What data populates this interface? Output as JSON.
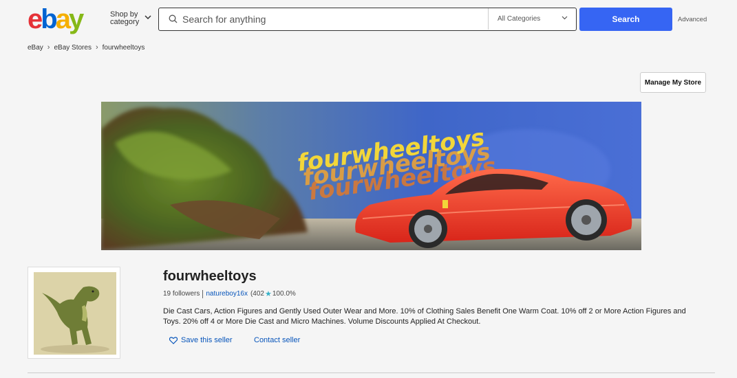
{
  "header": {
    "logo_text": "ebay",
    "shop_by_line1": "Shop by",
    "shop_by_line2": "category",
    "search_placeholder": "Search for anything",
    "category_selected": "All Categories",
    "search_button": "Search",
    "advanced_link": "Advanced"
  },
  "breadcrumb": [
    "eBay",
    "eBay Stores",
    "fourwheeltoys"
  ],
  "manage_button": "Manage My Store",
  "banner": {
    "text": "fourwheeltoys"
  },
  "store": {
    "name": "fourwheeltoys",
    "followers": "19 followers",
    "seller": "natureboy16x",
    "feedback_count": "(402",
    "feedback_percent": "100.0%",
    "description": "Die Cast Cars, Action Figures and Gently Used Outer Wear and More. 10% of Clothing Sales Benefit One Warm Coat. 10% off 2 or More Action Figures and Toys. 20% off 4 or More Die Cast and Micro Machines. Volume Discounts Applied At Checkout.",
    "save_label": "Save this seller",
    "contact_label": "Contact seller"
  },
  "colors": {
    "accent": "#3665f3",
    "link": "#0654ba",
    "logo_red": "#e53238",
    "logo_blue": "#0064d2",
    "logo_yellow": "#f5af02",
    "logo_green": "#86b817"
  }
}
